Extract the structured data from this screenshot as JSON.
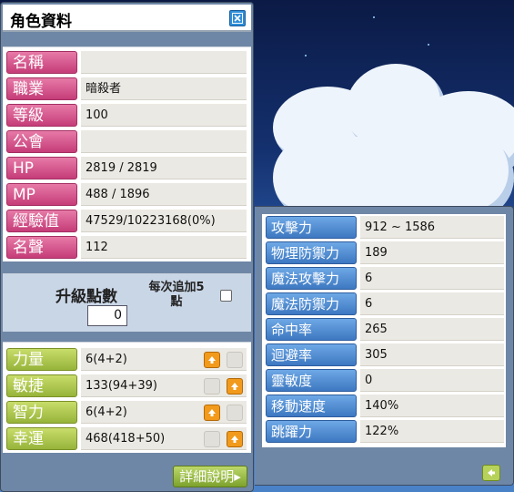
{
  "window": {
    "title": "角色資料"
  },
  "info": [
    {
      "label": "名稱",
      "value": ""
    },
    {
      "label": "職業",
      "value": "暗殺者"
    },
    {
      "label": "等級",
      "value": "100"
    },
    {
      "label": "公會",
      "value": ""
    },
    {
      "label": "HP",
      "value": "2819 / 2819"
    },
    {
      "label": "MP",
      "value": "488 / 1896"
    },
    {
      "label": "經驗值",
      "value": "47529/10223168(0%)"
    },
    {
      "label": "名聲",
      "value": "112"
    }
  ],
  "ability_points": {
    "label": "升級點數",
    "value": "0",
    "auto_add_label_line1": "每次追加5",
    "auto_add_label_line2": "點",
    "auto_add_checked": false
  },
  "stats": [
    {
      "label": "力量",
      "value": "6(4+2)"
    },
    {
      "label": "敏捷",
      "value": "133(94+39)"
    },
    {
      "label": "智力",
      "value": "6(4+2)"
    },
    {
      "label": "幸運",
      "value": "468(418+50)"
    }
  ],
  "detail_button_label": "詳細說明",
  "detail": [
    {
      "label": "攻擊力",
      "value": "912 ~ 1586"
    },
    {
      "label": "物理防禦力",
      "value": "189"
    },
    {
      "label": "魔法攻擊力",
      "value": "6"
    },
    {
      "label": "魔法防禦力",
      "value": "6"
    },
    {
      "label": "命中率",
      "value": "265"
    },
    {
      "label": "迴避率",
      "value": "305"
    },
    {
      "label": "靈敏度",
      "value": "0"
    },
    {
      "label": "移動速度",
      "value": "140%"
    },
    {
      "label": "跳躍力",
      "value": "122%"
    }
  ],
  "colors": {
    "info_label": "#c53c78",
    "stat_label": "#97b43a",
    "detail_label": "#3d78c1",
    "plus_button": "#f29a1c"
  },
  "icons": {
    "close": "close-icon",
    "plus": "up-arrow-icon",
    "back": "left-arrow-icon",
    "detail": "chevron-right-icon"
  }
}
